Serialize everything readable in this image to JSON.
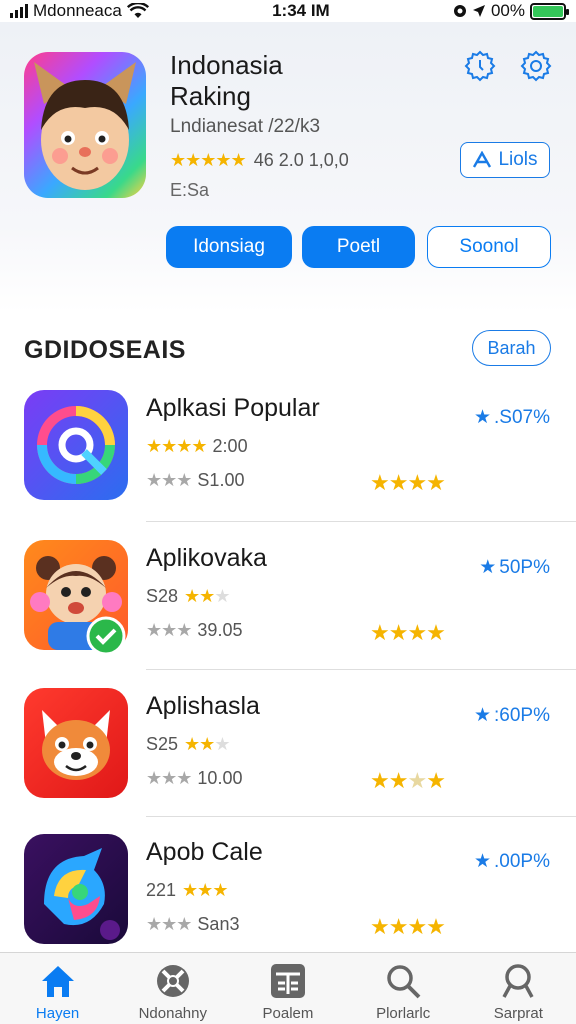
{
  "status": {
    "carrier": "Mdonneaca",
    "time": "1:34 IM",
    "battery": "00%",
    "battery_color": "#34c759"
  },
  "header": {
    "title_line1": "Indonasia",
    "title_line2": "Raking",
    "meta": "Lndianesat /22/k3",
    "rating_text": "46 2.0 1,0,0",
    "size": "E:Sa",
    "lists_label": "Liols",
    "icons": [
      "clock-icon",
      "gear-icon"
    ]
  },
  "actions": [
    "Idonsiag",
    "Poetl",
    "Soonol"
  ],
  "section": {
    "title": "GDIDOSEAIS",
    "button": "Barah"
  },
  "apps": [
    {
      "name": "Aplkasi Popular",
      "line1_prefix": "",
      "line1_text": "2:00",
      "line2_text": "S1.00",
      "pct": ".S07%"
    },
    {
      "name": "Aplikovaka",
      "line1_prefix": "S28",
      "line1_text": "",
      "line2_text": "39.05",
      "pct": "50P%"
    },
    {
      "name": "Aplishasla",
      "line1_prefix": "S25",
      "line1_text": "",
      "line2_text": "10.00",
      "pct": ":60P%"
    },
    {
      "name": "Apob Cale",
      "line1_prefix": "221",
      "line1_text": "",
      "line2_text": "San3",
      "pct": ".00P%"
    }
  ],
  "tabs": [
    {
      "label": "Hayen",
      "icon": "home-icon",
      "active": true
    },
    {
      "label": "Ndonahny",
      "icon": "tools-icon",
      "active": false
    },
    {
      "label": "Poalem",
      "icon": "calculator-icon",
      "active": false
    },
    {
      "label": "Plorlarlc",
      "icon": "search-icon",
      "active": false
    },
    {
      "label": "Sarprat",
      "icon": "search-icon",
      "active": false
    }
  ],
  "colors": {
    "accent": "#0a7cf2",
    "star": "#f5b400"
  }
}
